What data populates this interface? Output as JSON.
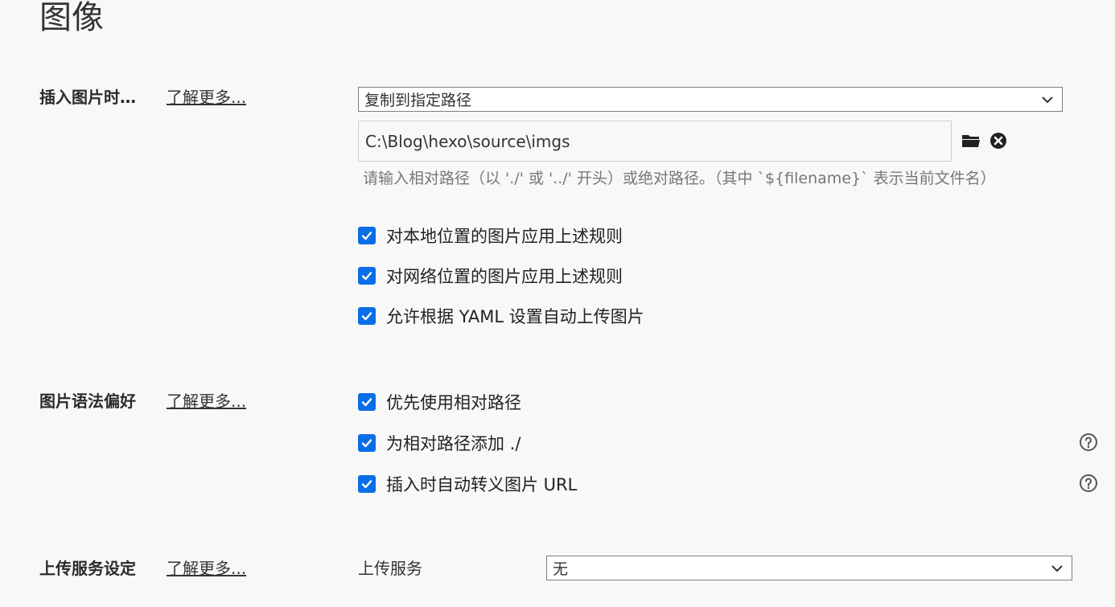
{
  "page": {
    "title": "图像"
  },
  "insert_image": {
    "label": "插入图片时…",
    "learn_more": "了解更多...",
    "action_select": "复制到指定路径",
    "path_value": "C:\\Blog\\hexo\\source\\imgs",
    "hint": "请输入相对路径（以 './' 或 '../' 开头）或绝对路径。（其中 `${filename}` 表示当前文件名）",
    "options": [
      {
        "label": "对本地位置的图片应用上述规则",
        "checked": true
      },
      {
        "label": "对网络位置的图片应用上述规则",
        "checked": true
      },
      {
        "label": "允许根据 YAML 设置自动上传图片",
        "checked": true
      }
    ]
  },
  "syntax_pref": {
    "label": "图片语法偏好",
    "learn_more": "了解更多...",
    "options": [
      {
        "label": "优先使用相对路径",
        "checked": true
      },
      {
        "label": "为相对路径添加 ./",
        "checked": true
      },
      {
        "label": "插入时自动转义图片 URL",
        "checked": true
      }
    ]
  },
  "upload": {
    "label": "上传服务设定",
    "learn_more": "了解更多...",
    "service_label": "上传服务",
    "service_value": "无"
  },
  "icons": {
    "folder": "folder-icon",
    "clear": "clear-circle-x-icon",
    "help": "help-circle-icon",
    "chevron": "chevron-down-icon",
    "check": "checkmark-icon"
  },
  "colors": {
    "background": "#f8f8f8",
    "checkbox": "#0a6ee6",
    "text": "#333333",
    "hint": "#777777"
  }
}
